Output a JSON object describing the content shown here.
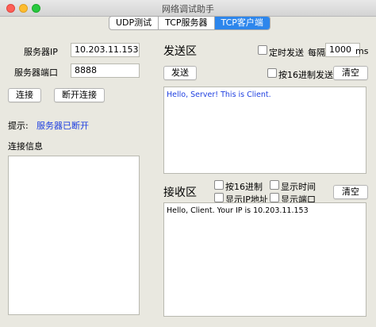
{
  "window": {
    "title": "网络调试助手"
  },
  "tabs": [
    {
      "label": "UDP测试",
      "active": false
    },
    {
      "label": "TCP服务器",
      "active": false
    },
    {
      "label": "TCP客户端",
      "active": true
    }
  ],
  "connection": {
    "server_ip_label": "服务器IP",
    "server_ip_value": "10.203.11.153",
    "server_port_label": "服务器端口",
    "server_port_value": "8888",
    "connect_label": "连接",
    "disconnect_label": "断开连接",
    "hint_label": "提示:",
    "hint_status": "服务器已断开",
    "info_label": "连接信息"
  },
  "send": {
    "title": "发送区",
    "send_button": "发送",
    "timed_send_label": "定时发送",
    "interval_label": "每隔",
    "interval_value": "1000",
    "interval_unit": "ms",
    "hex_send_label": "按16进制发送",
    "clear_label": "清空",
    "content": "Hello, Server! This is Client."
  },
  "receive": {
    "title": "接收区",
    "hex_label": "按16进制",
    "show_time_label": "显示时间",
    "show_ip_label": "显示IP地址",
    "show_port_label": "显示端口",
    "clear_label": "清空",
    "content": "Hello, Client. Your IP is 10.203.11.153"
  },
  "colors": {
    "accent": "#2d86ec",
    "status_text": "#1e3fe0",
    "window_bg": "#e9e8e0"
  }
}
